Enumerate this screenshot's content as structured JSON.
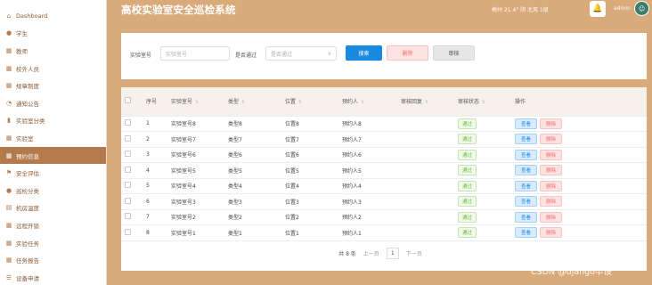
{
  "sidebar": {
    "items": [
      {
        "icon": "home-icon",
        "glyph": "⌂",
        "label": "Dashboard"
      },
      {
        "icon": "location-icon",
        "glyph": "●",
        "label": "学生"
      },
      {
        "icon": "grid-icon",
        "glyph": "▦",
        "label": "教师"
      },
      {
        "icon": "grid-icon",
        "glyph": "▦",
        "label": "校外人员"
      },
      {
        "icon": "grid-icon",
        "glyph": "▦",
        "label": "规章制度"
      },
      {
        "icon": "bell-icon",
        "glyph": "◔",
        "label": "通知公告"
      },
      {
        "icon": "bar-chart-icon",
        "glyph": "▮",
        "label": "实验室分类"
      },
      {
        "icon": "grid-icon",
        "glyph": "▦",
        "label": "实验室"
      },
      {
        "icon": "grid-icon",
        "glyph": "▦",
        "label": "预约信息"
      },
      {
        "icon": "flag-icon",
        "glyph": "⚑",
        "label": "安全评估"
      },
      {
        "icon": "user-icon",
        "glyph": "●",
        "label": "巡检分类"
      },
      {
        "icon": "document-icon",
        "glyph": "▤",
        "label": "机房温度"
      },
      {
        "icon": "grid-icon",
        "glyph": "▦",
        "label": "远程开锁"
      },
      {
        "icon": "grid-icon",
        "glyph": "▦",
        "label": "实验任务"
      },
      {
        "icon": "grid-icon",
        "glyph": "▦",
        "label": "任务报告"
      },
      {
        "icon": "list-icon",
        "glyph": "☰",
        "label": "设备申请"
      }
    ]
  },
  "header": {
    "title": "高校实验室安全巡检系统",
    "weather": "梅州  21.4°  阴  北风  1级",
    "username": "admin"
  },
  "search": {
    "lab_label": "实验室号",
    "lab_placeholder": "实验室号",
    "pass_label": "是否通过",
    "pass_placeholder": "是否通过",
    "search_btn": "搜索",
    "delete_btn": "删除",
    "audit_btn": "审核"
  },
  "table": {
    "headers": [
      "序号",
      "实验室号",
      "类型",
      "位置",
      "预约人",
      "审核回复",
      "审核状态",
      "操作"
    ],
    "view_label": "查看",
    "delete_label": "删除",
    "rows": [
      {
        "no": "1",
        "lab": "实验室号8",
        "type": "类型8",
        "loc": "位置8",
        "person": "预约人8",
        "reply": "",
        "status": "通过"
      },
      {
        "no": "2",
        "lab": "实验室号7",
        "type": "类型7",
        "loc": "位置7",
        "person": "预约人7",
        "reply": "",
        "status": "通过"
      },
      {
        "no": "3",
        "lab": "实验室号6",
        "type": "类型6",
        "loc": "位置6",
        "person": "预约人6",
        "reply": "",
        "status": "通过"
      },
      {
        "no": "4",
        "lab": "实验室号5",
        "type": "类型5",
        "loc": "位置5",
        "person": "预约人5",
        "reply": "",
        "status": "通过"
      },
      {
        "no": "5",
        "lab": "实验室号4",
        "type": "类型4",
        "loc": "位置4",
        "person": "预约人4",
        "reply": "",
        "status": "通过"
      },
      {
        "no": "6",
        "lab": "实验室号3",
        "type": "类型3",
        "loc": "位置3",
        "person": "预约人3",
        "reply": "",
        "status": "通过"
      },
      {
        "no": "7",
        "lab": "实验室号2",
        "type": "类型2",
        "loc": "位置2",
        "person": "预约人2",
        "reply": "",
        "status": "通过"
      },
      {
        "no": "8",
        "lab": "实验室号1",
        "type": "类型1",
        "loc": "位置1",
        "person": "预约人1",
        "reply": "",
        "status": "通过"
      }
    ]
  },
  "pagination": {
    "total": "共 8 条",
    "prev": "上一页",
    "page": "1",
    "next": "下一页"
  },
  "watermark": "CSDN @django毕设",
  "colors": {
    "accent": "#d9aa7a",
    "sidebar_active": "#b47a4c",
    "primary": "#1a89e0"
  }
}
